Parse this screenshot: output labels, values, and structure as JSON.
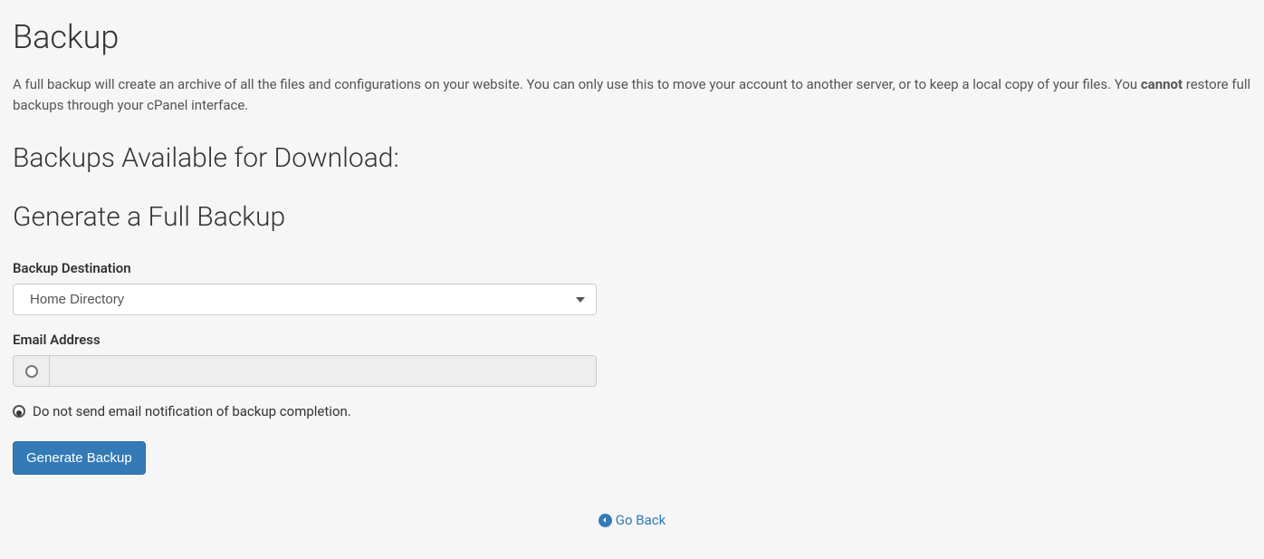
{
  "page": {
    "title": "Backup",
    "description_prefix": "A full backup will create an archive of all the files and configurations on your website. You can only use this to move your account to another server, or to keep a local copy of your files. You ",
    "description_bold": "cannot",
    "description_suffix": " restore full backups through your cPanel interface."
  },
  "sections": {
    "available": "Backups Available for Download:",
    "generate": "Generate a Full Backup"
  },
  "form": {
    "destination_label": "Backup Destination",
    "destination_value": "Home Directory",
    "email_label": "Email Address",
    "email_value": "",
    "no_email_label": "Do not send email notification of backup completion.",
    "submit_label": "Generate Backup"
  },
  "footer": {
    "go_back": "Go Back"
  }
}
